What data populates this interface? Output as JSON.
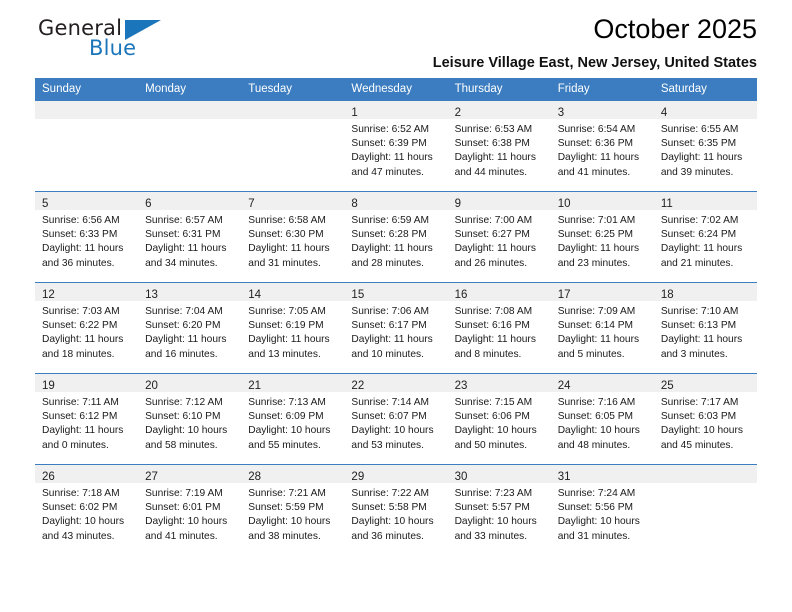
{
  "brand": {
    "name_top": "General",
    "name_bottom": "Blue",
    "accent_color": "#1b75bb",
    "triangle_icon": "triangle-icon"
  },
  "header": {
    "title": "October 2025",
    "subtitle": "Leisure Village East, New Jersey, United States"
  },
  "calendar": {
    "header_bg": "#3b7dc0",
    "header_text_color": "#ffffff",
    "daynum_band_bg": "#f0f0f0",
    "weekday_headers": [
      "Sunday",
      "Monday",
      "Tuesday",
      "Wednesday",
      "Thursday",
      "Friday",
      "Saturday"
    ],
    "labels": {
      "sunrise": "Sunrise:",
      "sunset": "Sunset:",
      "daylight": "Daylight:"
    },
    "weeks": [
      [
        {
          "day": "",
          "empty": true
        },
        {
          "day": "",
          "empty": true
        },
        {
          "day": "",
          "empty": true
        },
        {
          "day": "1",
          "sunrise": "Sunrise: 6:52 AM",
          "sunset": "Sunset: 6:39 PM",
          "daylight": "Daylight: 11 hours and 47 minutes."
        },
        {
          "day": "2",
          "sunrise": "Sunrise: 6:53 AM",
          "sunset": "Sunset: 6:38 PM",
          "daylight": "Daylight: 11 hours and 44 minutes."
        },
        {
          "day": "3",
          "sunrise": "Sunrise: 6:54 AM",
          "sunset": "Sunset: 6:36 PM",
          "daylight": "Daylight: 11 hours and 41 minutes."
        },
        {
          "day": "4",
          "sunrise": "Sunrise: 6:55 AM",
          "sunset": "Sunset: 6:35 PM",
          "daylight": "Daylight: 11 hours and 39 minutes."
        }
      ],
      [
        {
          "day": "5",
          "sunrise": "Sunrise: 6:56 AM",
          "sunset": "Sunset: 6:33 PM",
          "daylight": "Daylight: 11 hours and 36 minutes."
        },
        {
          "day": "6",
          "sunrise": "Sunrise: 6:57 AM",
          "sunset": "Sunset: 6:31 PM",
          "daylight": "Daylight: 11 hours and 34 minutes."
        },
        {
          "day": "7",
          "sunrise": "Sunrise: 6:58 AM",
          "sunset": "Sunset: 6:30 PM",
          "daylight": "Daylight: 11 hours and 31 minutes."
        },
        {
          "day": "8",
          "sunrise": "Sunrise: 6:59 AM",
          "sunset": "Sunset: 6:28 PM",
          "daylight": "Daylight: 11 hours and 28 minutes."
        },
        {
          "day": "9",
          "sunrise": "Sunrise: 7:00 AM",
          "sunset": "Sunset: 6:27 PM",
          "daylight": "Daylight: 11 hours and 26 minutes."
        },
        {
          "day": "10",
          "sunrise": "Sunrise: 7:01 AM",
          "sunset": "Sunset: 6:25 PM",
          "daylight": "Daylight: 11 hours and 23 minutes."
        },
        {
          "day": "11",
          "sunrise": "Sunrise: 7:02 AM",
          "sunset": "Sunset: 6:24 PM",
          "daylight": "Daylight: 11 hours and 21 minutes."
        }
      ],
      [
        {
          "day": "12",
          "sunrise": "Sunrise: 7:03 AM",
          "sunset": "Sunset: 6:22 PM",
          "daylight": "Daylight: 11 hours and 18 minutes."
        },
        {
          "day": "13",
          "sunrise": "Sunrise: 7:04 AM",
          "sunset": "Sunset: 6:20 PM",
          "daylight": "Daylight: 11 hours and 16 minutes."
        },
        {
          "day": "14",
          "sunrise": "Sunrise: 7:05 AM",
          "sunset": "Sunset: 6:19 PM",
          "daylight": "Daylight: 11 hours and 13 minutes."
        },
        {
          "day": "15",
          "sunrise": "Sunrise: 7:06 AM",
          "sunset": "Sunset: 6:17 PM",
          "daylight": "Daylight: 11 hours and 10 minutes."
        },
        {
          "day": "16",
          "sunrise": "Sunrise: 7:08 AM",
          "sunset": "Sunset: 6:16 PM",
          "daylight": "Daylight: 11 hours and 8 minutes."
        },
        {
          "day": "17",
          "sunrise": "Sunrise: 7:09 AM",
          "sunset": "Sunset: 6:14 PM",
          "daylight": "Daylight: 11 hours and 5 minutes."
        },
        {
          "day": "18",
          "sunrise": "Sunrise: 7:10 AM",
          "sunset": "Sunset: 6:13 PM",
          "daylight": "Daylight: 11 hours and 3 minutes."
        }
      ],
      [
        {
          "day": "19",
          "sunrise": "Sunrise: 7:11 AM",
          "sunset": "Sunset: 6:12 PM",
          "daylight": "Daylight: 11 hours and 0 minutes."
        },
        {
          "day": "20",
          "sunrise": "Sunrise: 7:12 AM",
          "sunset": "Sunset: 6:10 PM",
          "daylight": "Daylight: 10 hours and 58 minutes."
        },
        {
          "day": "21",
          "sunrise": "Sunrise: 7:13 AM",
          "sunset": "Sunset: 6:09 PM",
          "daylight": "Daylight: 10 hours and 55 minutes."
        },
        {
          "day": "22",
          "sunrise": "Sunrise: 7:14 AM",
          "sunset": "Sunset: 6:07 PM",
          "daylight": "Daylight: 10 hours and 53 minutes."
        },
        {
          "day": "23",
          "sunrise": "Sunrise: 7:15 AM",
          "sunset": "Sunset: 6:06 PM",
          "daylight": "Daylight: 10 hours and 50 minutes."
        },
        {
          "day": "24",
          "sunrise": "Sunrise: 7:16 AM",
          "sunset": "Sunset: 6:05 PM",
          "daylight": "Daylight: 10 hours and 48 minutes."
        },
        {
          "day": "25",
          "sunrise": "Sunrise: 7:17 AM",
          "sunset": "Sunset: 6:03 PM",
          "daylight": "Daylight: 10 hours and 45 minutes."
        }
      ],
      [
        {
          "day": "26",
          "sunrise": "Sunrise: 7:18 AM",
          "sunset": "Sunset: 6:02 PM",
          "daylight": "Daylight: 10 hours and 43 minutes."
        },
        {
          "day": "27",
          "sunrise": "Sunrise: 7:19 AM",
          "sunset": "Sunset: 6:01 PM",
          "daylight": "Daylight: 10 hours and 41 minutes."
        },
        {
          "day": "28",
          "sunrise": "Sunrise: 7:21 AM",
          "sunset": "Sunset: 5:59 PM",
          "daylight": "Daylight: 10 hours and 38 minutes."
        },
        {
          "day": "29",
          "sunrise": "Sunrise: 7:22 AM",
          "sunset": "Sunset: 5:58 PM",
          "daylight": "Daylight: 10 hours and 36 minutes."
        },
        {
          "day": "30",
          "sunrise": "Sunrise: 7:23 AM",
          "sunset": "Sunset: 5:57 PM",
          "daylight": "Daylight: 10 hours and 33 minutes."
        },
        {
          "day": "31",
          "sunrise": "Sunrise: 7:24 AM",
          "sunset": "Sunset: 5:56 PM",
          "daylight": "Daylight: 10 hours and 31 minutes."
        },
        {
          "day": "",
          "empty": true
        }
      ]
    ]
  }
}
